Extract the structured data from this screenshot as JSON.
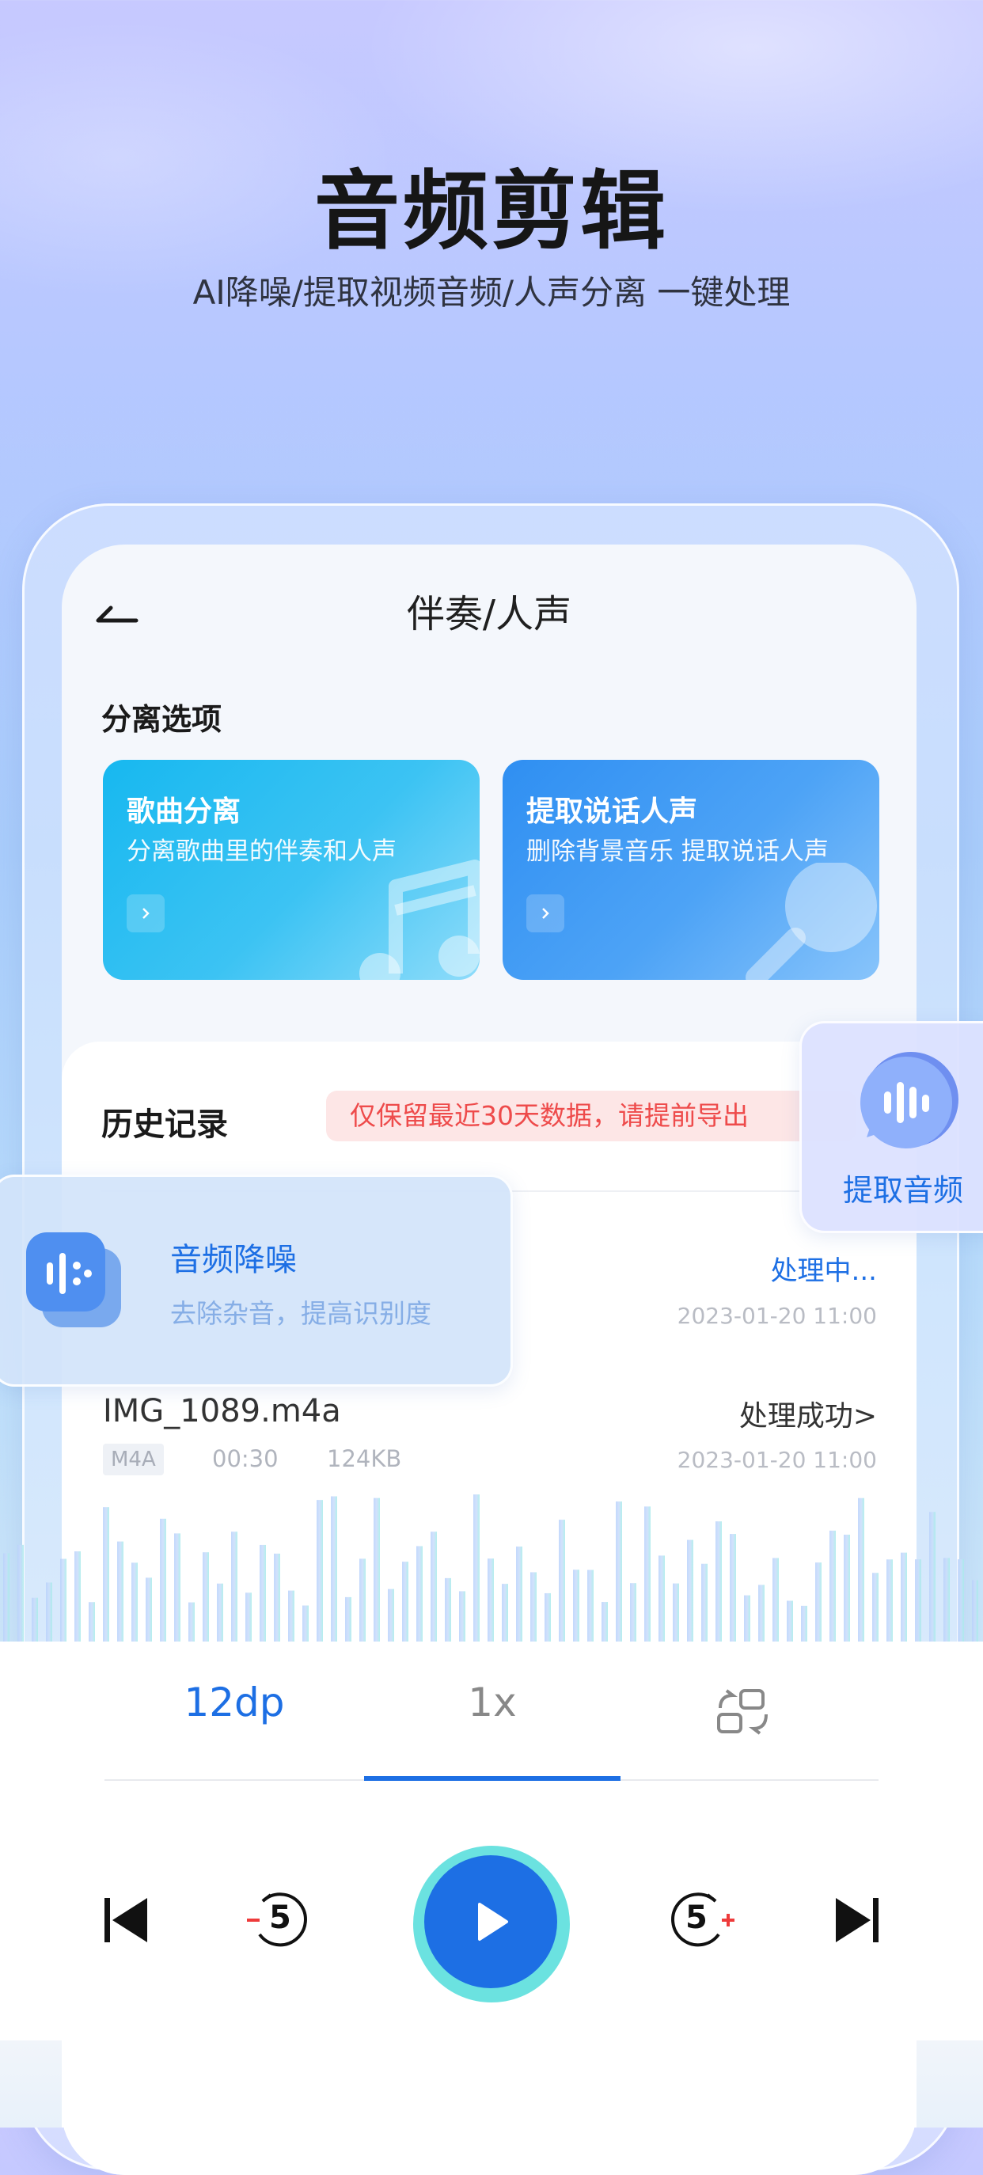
{
  "hero": {
    "title": "音频剪辑",
    "subtitle": "AI降噪/提取视频音频/人声分离 一键处理"
  },
  "screen": {
    "nav_title": "伴奏/人声",
    "section_title": "分离选项",
    "cards": [
      {
        "title": "歌曲分离",
        "desc": "分离歌曲里的伴奏和人声"
      },
      {
        "title": "提取说话人声",
        "desc": "删除背景音乐 提取说话人声"
      }
    ],
    "history": {
      "title": "历史记录",
      "notice": "仅保留最近30天数据，请提前导出",
      "rows": [
        {
          "status": "处理中...",
          "time": "2023-01-20 11:00"
        },
        {
          "name": "IMG_1089.m4a",
          "format": "M4A",
          "duration": "00:30",
          "size": "124KB",
          "status": "处理成功>",
          "time": "2023-01-20 11:00"
        }
      ]
    }
  },
  "float_left": {
    "title": "音频降噪",
    "desc": "去除杂音，提高识别度"
  },
  "float_right": {
    "label": "提取音频"
  },
  "controls": {
    "tabs": [
      "12dp",
      "1x"
    ],
    "active_tab": 1,
    "icons": [
      "loop-switch-icon",
      "skip-previous-icon",
      "rewind-5-icon",
      "play-icon",
      "forward-5-icon",
      "skip-next-icon"
    ],
    "rewind_label": "5",
    "forward_label": "5"
  },
  "colors": {
    "accent": "#1d6fe4",
    "play_ring": "#6be2e0",
    "notice_text": "#ee4b4b"
  }
}
